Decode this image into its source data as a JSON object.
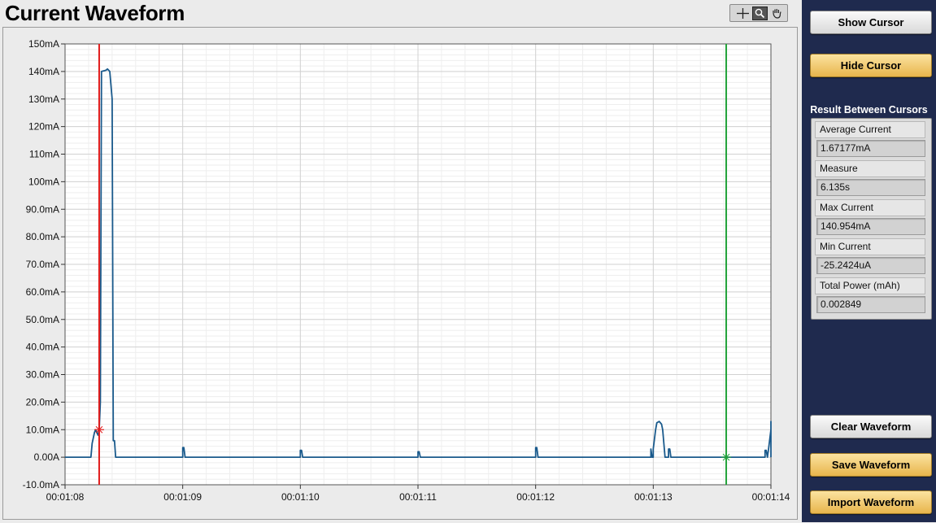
{
  "title": "Current Waveform",
  "palette": {
    "cursor_icon": "crosshair-icon",
    "zoom_icon": "zoom-icon",
    "pan_icon": "hand-icon"
  },
  "buttons": {
    "show_cursor": "Show Cursor",
    "hide_cursor": "Hide Cursor",
    "clear_waveform": "Clear Waveform",
    "save_waveform": "Save Waveform",
    "import_waveform": "Import Waveform"
  },
  "results": {
    "title": "Result Between Cursors",
    "average_current_label": "Average Current",
    "average_current_value": "1.67177mA",
    "measure_label": "Measure",
    "measure_value": "6.135s",
    "max_current_label": "Max Current",
    "max_current_value": "140.954mA",
    "min_current_label": "Min Current",
    "min_current_value": "-25.2424uA",
    "total_power_label": "Total Power (mAh)",
    "total_power_value": "0.002849"
  },
  "colors": {
    "trace": "#1a5a8c",
    "cursor1": "#e11b1b",
    "cursor2": "#22a33a",
    "panel_bg": "#1f2a4e",
    "button_gold": "#e8b54c"
  },
  "chart_data": {
    "type": "line",
    "title": "",
    "xlabel": "",
    "ylabel": "",
    "xlim": [
      68,
      74
    ],
    "ylim": [
      -10,
      150
    ],
    "x_tick_values": [
      68,
      69,
      70,
      71,
      72,
      73,
      74
    ],
    "x_tick_labels": [
      "00:01:08",
      "00:01:09",
      "00:01:10",
      "00:01:11",
      "00:01:12",
      "00:01:13",
      "00:01:14"
    ],
    "y_tick_values": [
      -10,
      0,
      10,
      20,
      30,
      40,
      50,
      60,
      70,
      80,
      90,
      100,
      110,
      120,
      130,
      140,
      150
    ],
    "y_tick_labels": [
      "-10.0mA",
      "0.00A",
      "10.0mA",
      "20.0mA",
      "30.0mA",
      "40.0mA",
      "50.0mA",
      "60.0mA",
      "70.0mA",
      "80.0mA",
      "90.0mA",
      "100mA",
      "110mA",
      "120mA",
      "130mA",
      "140mA",
      "150mA"
    ],
    "grid": true,
    "cursors": [
      {
        "x": 68.29,
        "y": 10
      },
      {
        "x": 73.62,
        "y": 0
      }
    ],
    "series": [
      {
        "x": [
          68.0,
          68.22,
          68.23,
          68.25,
          68.26,
          68.28,
          68.29,
          68.3,
          68.31,
          68.35,
          68.36,
          68.37,
          68.38,
          68.4,
          68.41,
          68.42,
          68.43,
          68.44,
          68.45,
          69.0,
          69.0,
          69.01,
          69.02,
          69.02,
          70.0,
          70.0,
          70.01,
          70.02,
          70.02,
          71.0,
          71.0,
          71.01,
          71.02,
          71.02,
          72.0,
          72.0,
          72.01,
          72.02,
          72.02,
          72.98,
          72.98,
          72.99,
          73.0,
          73.0,
          73.02,
          73.03,
          73.05,
          73.07,
          73.08,
          73.1,
          73.12,
          73.13,
          73.13,
          73.14,
          73.15,
          73.15,
          73.95,
          73.95,
          73.96,
          73.97,
          73.97,
          73.98,
          74.0,
          74.02,
          74.03,
          74.05,
          74.07,
          74.08,
          74.1,
          74.1,
          74.8
        ],
        "y": [
          0,
          0,
          5,
          9,
          10,
          8,
          10,
          20,
          140,
          140.5,
          140.9,
          140.5,
          140,
          130,
          6,
          6,
          0,
          0,
          0,
          0,
          3.5,
          3.5,
          0,
          0,
          0,
          2.5,
          2.5,
          0,
          0,
          0,
          2,
          2,
          0,
          0,
          0,
          3.5,
          3.5,
          0,
          0,
          0,
          3,
          0,
          0,
          3,
          10,
          12.5,
          13,
          12,
          10,
          0,
          0,
          0,
          3,
          3,
          0,
          0,
          0,
          2.5,
          2.5,
          0,
          0,
          3,
          10,
          12.5,
          13,
          12,
          10,
          0,
          0,
          0,
          0
        ]
      }
    ]
  }
}
